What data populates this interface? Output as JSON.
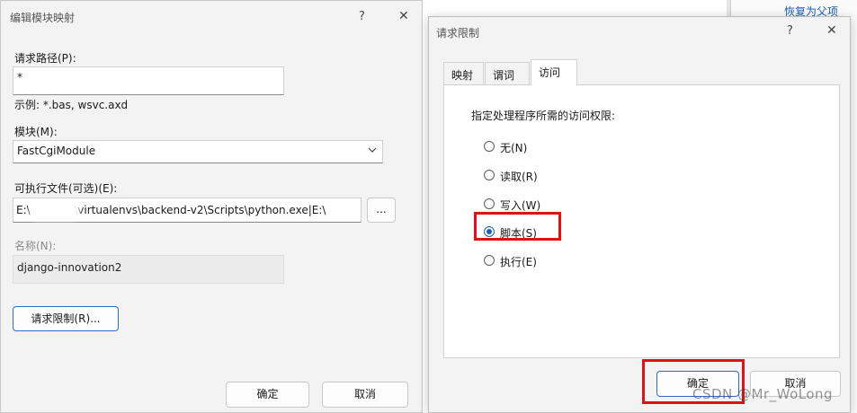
{
  "background": {
    "link_text": "恢复为父项"
  },
  "left_dialog": {
    "title": "编辑模块映射",
    "help_glyph": "?",
    "close_glyph": "✕",
    "request_path": {
      "label": "请求路径(P):",
      "value": "*",
      "example": "示例: *.bas, wsvc.axd"
    },
    "module": {
      "label": "模块(M):",
      "selected": "FastCgiModule"
    },
    "executable": {
      "label": "可执行文件(可选)(E):",
      "value": "E:\\       ovation\\virtualenvs\\backend-v2\\Scripts\\python.exe|E:\\",
      "browse_label": "..."
    },
    "name": {
      "label": "名称(N):",
      "value": "django-innovation2"
    },
    "request_restrictions_label": "请求限制(R)...",
    "ok_label": "确定",
    "cancel_label": "取消"
  },
  "right_dialog": {
    "title": "请求限制",
    "help_glyph": "?",
    "close_glyph": "✕",
    "tabs": [
      {
        "label": "映射",
        "active": false
      },
      {
        "label": "谓词",
        "active": false
      },
      {
        "label": "访问",
        "active": true
      }
    ],
    "instruction": "指定处理程序所需的访问权限:",
    "options": [
      {
        "label": "无(N)",
        "checked": false
      },
      {
        "label": "读取(R)",
        "checked": false
      },
      {
        "label": "写入(W)",
        "checked": false
      },
      {
        "label": "脚本(S)",
        "checked": true
      },
      {
        "label": "执行(E)",
        "checked": false
      }
    ],
    "ok_label": "确定",
    "cancel_label": "取消"
  },
  "watermark": "CSDN @Mr_WoLong",
  "colors": {
    "highlight_red": "#e0101a",
    "accent_blue": "#1f5fb8"
  }
}
